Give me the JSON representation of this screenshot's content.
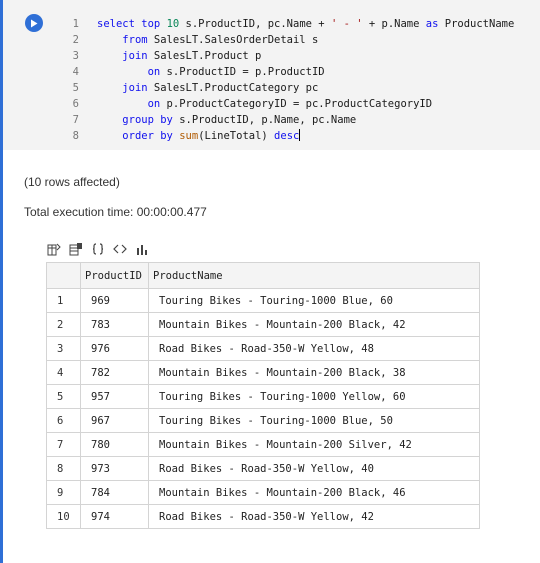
{
  "code": {
    "run_button_icon": "play-icon",
    "lines": [
      {
        "n": "1",
        "html": "<span class=\"kw\">select</span> <span class=\"kw\">top</span> <span class=\"num\">10</span> s.ProductID, pc.Name + <span class=\"str\">' - '</span> + p.Name <span class=\"kw\">as</span> ProductName"
      },
      {
        "n": "2",
        "html": "    <span class=\"kw\">from</span> SalesLT.SalesOrderDetail s"
      },
      {
        "n": "3",
        "html": "    <span class=\"kw\">join</span> SalesLT.Product p"
      },
      {
        "n": "4",
        "html": "        <span class=\"kw\">on</span> s.ProductID = p.ProductID"
      },
      {
        "n": "5",
        "html": "    <span class=\"kw\">join</span> SalesLT.ProductCategory pc"
      },
      {
        "n": "6",
        "html": "        <span class=\"kw\">on</span> p.ProductCategoryID = pc.ProductCategoryID"
      },
      {
        "n": "7",
        "html": "    <span class=\"kw\">group</span> <span class=\"kw\">by</span> s.ProductID, p.Name, pc.Name"
      },
      {
        "n": "8",
        "html": "    <span class=\"kw\">order</span> <span class=\"kw\">by</span> <span class=\"fn\">sum</span>(LineTotal) <span class=\"kw\">desc</span><span class=\"cursor\"></span>"
      }
    ]
  },
  "messages": {
    "rows_affected": "(10 rows affected)",
    "execution_time": "Total execution time: 00:00:00.477"
  },
  "toolbar": {
    "icons": [
      "save-as-csv-icon",
      "save-as-excel-icon",
      "save-as-json-icon",
      "save-as-xml-icon",
      "chart-icon"
    ]
  },
  "results": {
    "columns": [
      "",
      "ProductID",
      "ProductName"
    ],
    "rows": [
      {
        "n": "1",
        "id": "969",
        "name": "Touring Bikes - Touring-1000 Blue, 60"
      },
      {
        "n": "2",
        "id": "783",
        "name": "Mountain Bikes - Mountain-200 Black, 42"
      },
      {
        "n": "3",
        "id": "976",
        "name": "Road Bikes - Road-350-W Yellow, 48"
      },
      {
        "n": "4",
        "id": "782",
        "name": "Mountain Bikes - Mountain-200 Black, 38"
      },
      {
        "n": "5",
        "id": "957",
        "name": "Touring Bikes - Touring-1000 Yellow, 60"
      },
      {
        "n": "6",
        "id": "967",
        "name": "Touring Bikes - Touring-1000 Blue, 50"
      },
      {
        "n": "7",
        "id": "780",
        "name": "Mountain Bikes - Mountain-200 Silver, 42"
      },
      {
        "n": "8",
        "id": "973",
        "name": "Road Bikes - Road-350-W Yellow, 40"
      },
      {
        "n": "9",
        "id": "784",
        "name": "Mountain Bikes - Mountain-200 Black, 46"
      },
      {
        "n": "10",
        "id": "974",
        "name": "Road Bikes - Road-350-W Yellow, 42"
      }
    ]
  },
  "colors": {
    "accent": "#2f6fd6",
    "keyword": "#1010ee",
    "code_background": "#f3f3f3"
  }
}
